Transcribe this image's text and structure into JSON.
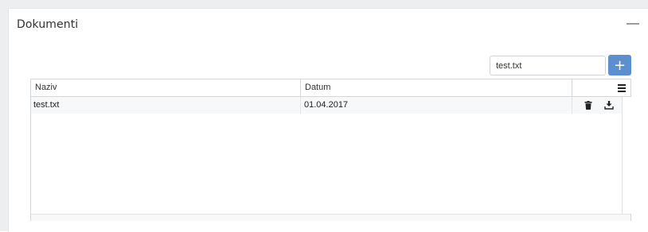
{
  "panel": {
    "title": "Dokumenti",
    "collapse_symbol": "—",
    "collapse_icon": "minus-icon"
  },
  "upload": {
    "filename": "test.txt",
    "upload_icon": "upload-icon",
    "add_symbol": "+",
    "add_icon": "plus-icon"
  },
  "grid": {
    "columns": [
      "Naziv",
      "Datum"
    ],
    "menu_icon": "hamburger-menu-icon",
    "rows": [
      {
        "naziv": "test.txt",
        "datum": "01.04.2017",
        "actions": [
          "trash-icon",
          "download-icon"
        ]
      }
    ]
  },
  "colors": {
    "accent": "#5b8fd0",
    "frame": "#eceeef",
    "row_bg": "#f7f8f9",
    "border": "#d4d7da"
  }
}
